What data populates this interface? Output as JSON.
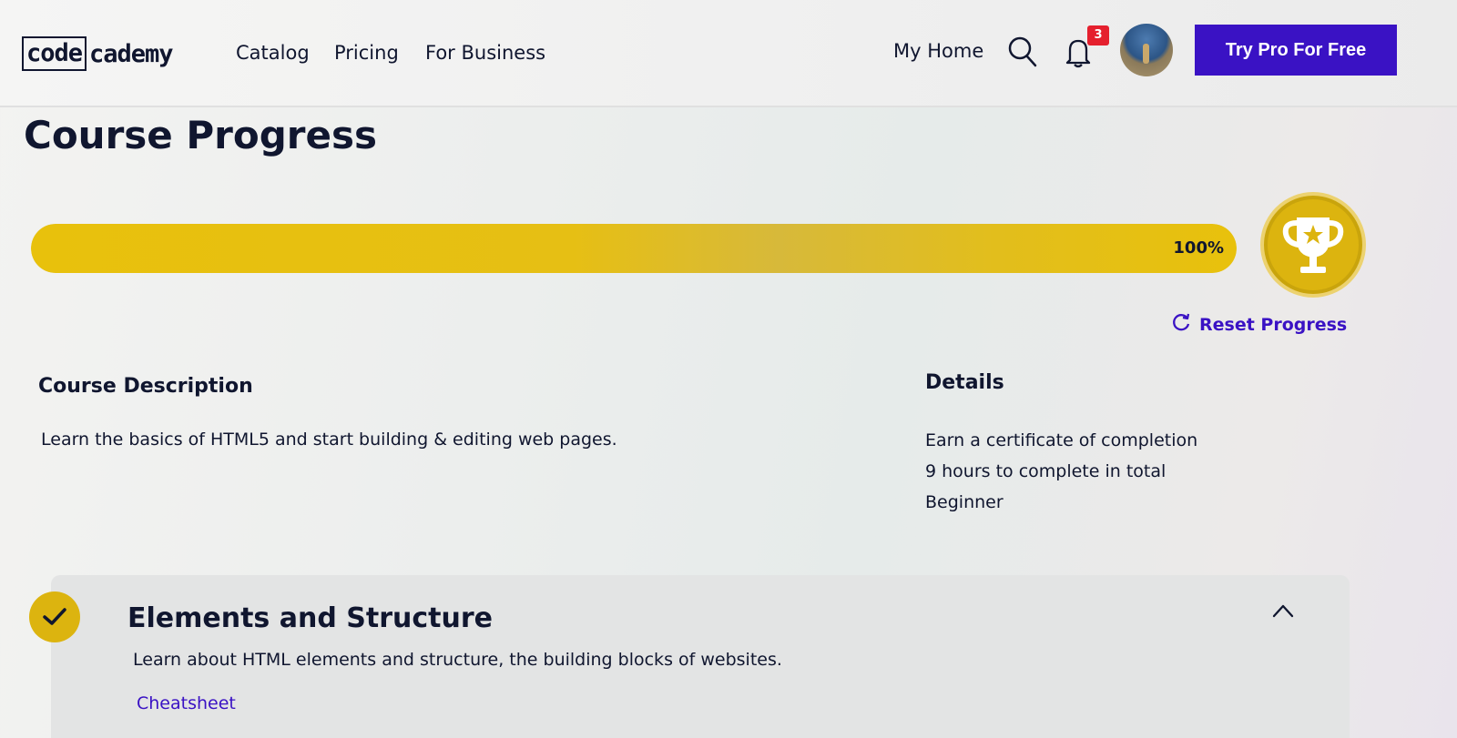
{
  "header": {
    "logo_boxed": "code",
    "logo_rest": "cademy",
    "nav": {
      "catalog": "Catalog",
      "pricing": "Pricing",
      "for_business": "For Business",
      "my_home": "My Home"
    },
    "notification_count": "3",
    "cta_label": "Try Pro For Free"
  },
  "page": {
    "title": "Course Progress",
    "progress": {
      "percent": 100,
      "label": "100%"
    },
    "reset_label": "Reset Progress"
  },
  "description": {
    "heading": "Course Description",
    "text": "Learn the basics of HTML5 and start building & editing web pages."
  },
  "details": {
    "heading": "Details",
    "items": [
      "Earn a certificate of completion",
      "9 hours to complete in total",
      "Beginner"
    ]
  },
  "module": {
    "title": "Elements and Structure",
    "description": "Learn about HTML elements and structure, the building blocks of websites.",
    "link": "Cheatsheet",
    "completed": true,
    "expanded": true
  },
  "colors": {
    "brand_purple": "#3a12c4",
    "progress_yellow": "#e6bf14",
    "text_navy": "#10162f",
    "badge_red": "#e5202e"
  },
  "icons": {
    "search": "search-icon",
    "notifications": "bell-icon",
    "trophy": "trophy-icon",
    "reset": "refresh-icon",
    "check": "check-icon",
    "collapse": "chevron-up-icon"
  }
}
